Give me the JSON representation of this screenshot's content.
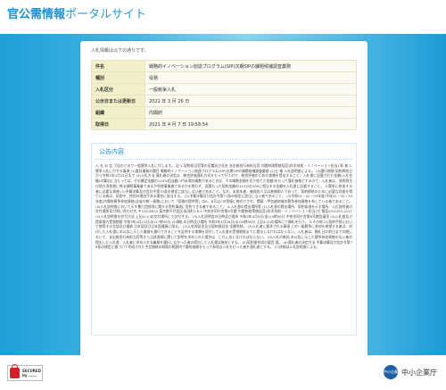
{
  "header": {
    "title_main": "官公需情報",
    "title_sub": "ポータルサイト"
  },
  "card": {
    "intro": "入札情報は以下の通りです。",
    "table": [
      {
        "label": "件名",
        "value": "戦略的イノベーション創造プログラム(SIP)次期SIPの課題候補調査業務"
      },
      {
        "label": "種別",
        "value": "役務"
      },
      {
        "label": "入札区分",
        "value": "一般競争入札"
      },
      {
        "label": "公示日または更新日",
        "value": "2021 年 3 月 26 日"
      },
      {
        "label": "組織",
        "value": "内閣府"
      },
      {
        "label": "取得日",
        "value": "2021 年 4 月 7 日 19:58:54"
      }
    ],
    "notice_title": "公告内容",
    "notice_body": "入 札 公 告 下記のとおり一般競争入札に付します。 記 1.契約担当官等の官職及び氏名 支出負担行為担当官 内閣府政策統括官(科学技術・イノベーション担当) 幹 者 2.競争入札に付する事項 (1)委託業務の題目 戦略的イノベーション創造プログラム(SIP)次期SIPの課題候補調査業務 (2)仕 様 入札説明書による。 (3)履行期間 契約締結日から令和4年3月31日まで (4)入札方法 落札者の決定は、総合評価落札方式をもって行うので、総合評価のための書類を提出すること。入札書に記載された金額(入札金額)の算出に当たっては、その算定金額の110%相当額(1円未満の端数があるときは、その端数金額を切り捨てた金額)をもって落札価格とするので、入札者は、消費税及び地方消費税に係る課税事業者であるか免税事業者であるかを問わず、見積もった契約金額の110分の100に相当する金額を入札書に記載すること。 3.競争に参加する者に必要な資格 (1)予算決算及び会計令第70条の規定に該当しない者であること。なお、未成年者、被保佐人又は被補助人であって、契約締結のために必要な同意を得ている者は、同条中、特別の理由がある場合に該当する。 (2)予算決算及び会計令第71条の規定に該当しない者であること。 (3)令和01・02・03年度(平成31・32・33年度)内閣府競争参加資格(全省庁統一資格)において「役務の提供等」のA、B又はCの等級に格付けされ、関東・甲信越地域の競争参加資格を有している者であること。 (4)入札説明書において示す暴力団排除に関する誓約事項に誓約できる者であること。 4.入札書の提出場所等 (1)入札書の提出場所、契約条項を示す場所、入札説明書の交付場所及び問い合わせ先 〒100-8914 東京都千代田区永田町1-6-1 中央合同庁舎第8号館 内閣府政策統括官(科学技術・イノベーション担当)付 電話03-5253-2111 (2)入札説明書の交付方法 上記4.(1)の交付場所にて交付する。 (3)入札説明会の日時及び場所 令和3年4月9日(金)14時00分 中央合同庁舎第8号館会議室 (4)入札書及び提案書の受領期限 令和3年4月21日(水)17時00分 (5)開札の日時及び場所 令和3年4月28日(水)14時00分 上記4.(1)の場所にて開札を行う。 5.その他 (1)契約手続において使用する言語及び通貨 日本語及び日本国通貨に限る。 (2)入札保証金及び契約保証金 全額免除。 (3)入札者に要求される事項 この一般競争に参加を希望する者は、封印した入札書に本公告に示した業務を履行できることを証明する書類を添付して入札書の受領期限までに提出しなければならない。入札者は、開札日の前日までの間において、支出負担行為担当官等から当該書類に関して説明を求められた場合は、これに応じなければならない。 (4)入札の無効 本公告に示した競争参加資格のない者の提出した入札書、入札者に求められる義務を履行しなかった者の提出した入札書は無効とする。 (5)契約書作成の要否 要。 (6)落札者の決定方法 予算決算及び会計令第79条の規定に基づいて作成された予定価格の制限の範囲内で最低価格をもって有効な入札を行った者を落札者とする。 (7)詳細は入札説明書による。"
  },
  "footer": {
    "badge_line1": "SECURED",
    "badge_line2": "by ......",
    "logo_mark": "中小企業",
    "logo_text": "中小企業庁"
  },
  "colors": {
    "brand_blue": "#1b8fd3",
    "label_bg": "#f2f0c9",
    "lock_red": "#d61f26"
  }
}
